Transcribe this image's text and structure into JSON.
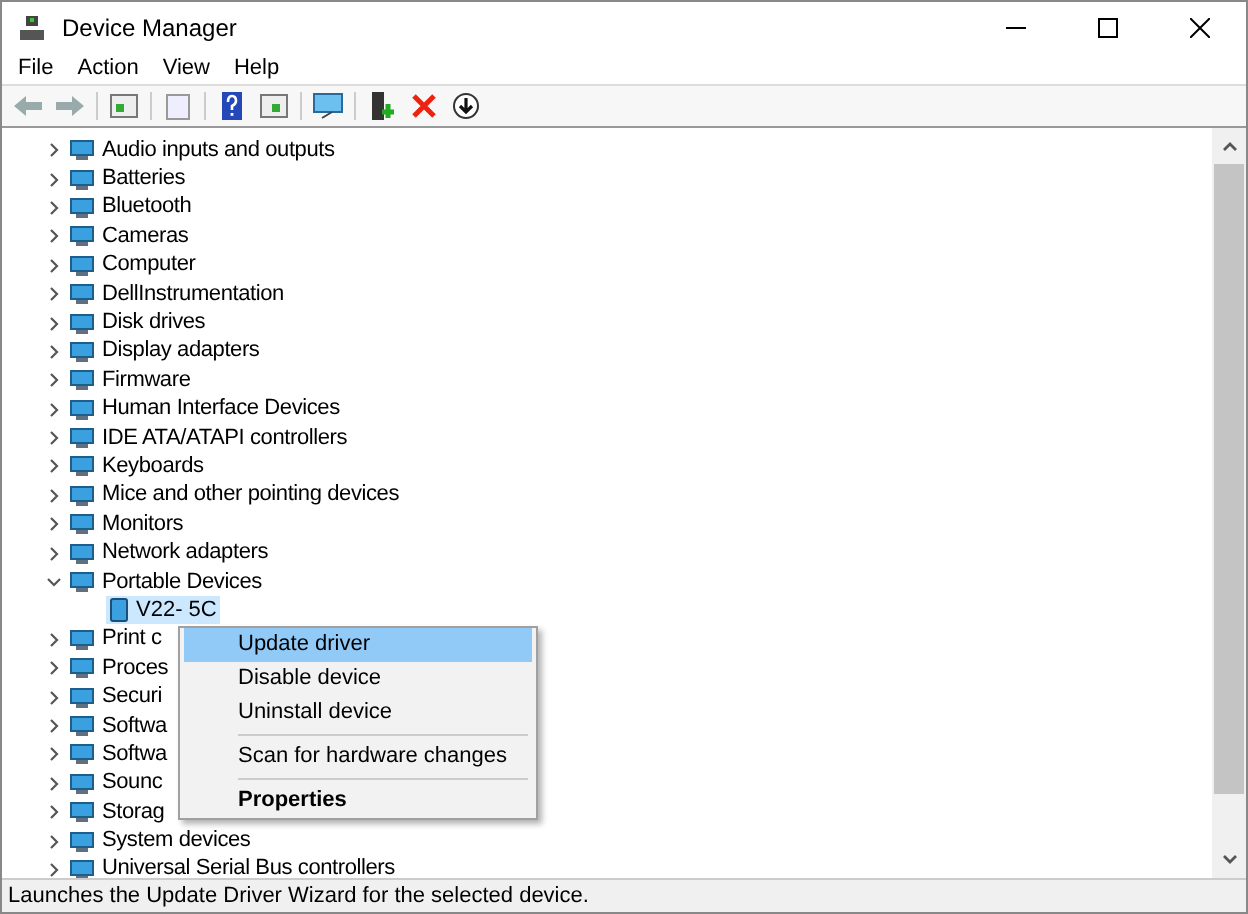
{
  "window": {
    "title": "Device Manager"
  },
  "menu_bar": [
    "File",
    "Action",
    "View",
    "Help"
  ],
  "tree": [
    {
      "label": "Audio inputs and outputs",
      "expanded": false
    },
    {
      "label": "Batteries",
      "expanded": false
    },
    {
      "label": "Bluetooth",
      "expanded": false
    },
    {
      "label": "Cameras",
      "expanded": false
    },
    {
      "label": "Computer",
      "expanded": false
    },
    {
      "label": "DellInstrumentation",
      "expanded": false
    },
    {
      "label": "Disk drives",
      "expanded": false
    },
    {
      "label": "Display adapters",
      "expanded": false
    },
    {
      "label": "Firmware",
      "expanded": false
    },
    {
      "label": "Human Interface Devices",
      "expanded": false
    },
    {
      "label": "IDE ATA/ATAPI controllers",
      "expanded": false
    },
    {
      "label": "Keyboards",
      "expanded": false
    },
    {
      "label": "Mice and other pointing devices",
      "expanded": false
    },
    {
      "label": "Monitors",
      "expanded": false
    },
    {
      "label": "Network adapters",
      "expanded": false
    },
    {
      "label": "Portable Devices",
      "expanded": true,
      "children": [
        {
          "label": "V22- 5C",
          "selected": true
        }
      ]
    },
    {
      "label": "Print c",
      "expanded": false
    },
    {
      "label": "Proces",
      "expanded": false
    },
    {
      "label": "Securi",
      "expanded": false
    },
    {
      "label": "Softwa",
      "expanded": false
    },
    {
      "label": "Softwa",
      "expanded": false
    },
    {
      "label": "Sounc",
      "expanded": false
    },
    {
      "label": "Storag",
      "expanded": false
    },
    {
      "label": "System devices",
      "expanded": false
    },
    {
      "label": "Universal Serial Bus controllers",
      "expanded": false
    }
  ],
  "context_menu": [
    {
      "kind": "item",
      "label": "Update driver",
      "selected": true,
      "default": false
    },
    {
      "kind": "item",
      "label": "Disable device",
      "selected": false,
      "default": false
    },
    {
      "kind": "item",
      "label": "Uninstall device",
      "selected": false,
      "default": false
    },
    {
      "kind": "separator"
    },
    {
      "kind": "item",
      "label": "Scan for hardware changes",
      "selected": false,
      "default": false
    },
    {
      "kind": "separator"
    },
    {
      "kind": "item",
      "label": "Properties",
      "selected": false,
      "default": true
    }
  ],
  "status_bar": "Launches the Update Driver Wizard for the selected device."
}
